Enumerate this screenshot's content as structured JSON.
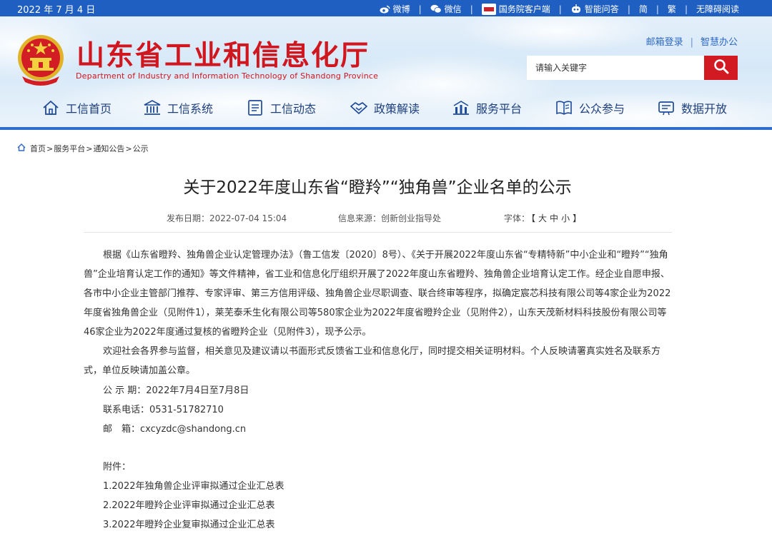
{
  "topbar": {
    "date": "2022 年 7 月 4 日",
    "links": [
      {
        "icon": "weibo-icon",
        "label": "微博"
      },
      {
        "icon": "wechat-icon",
        "label": "微信"
      },
      {
        "icon": "gwy-app-icon",
        "label": "国务院客户端"
      },
      {
        "icon": "robot-icon",
        "label": "智能问答"
      },
      {
        "icon": "",
        "label": "简"
      },
      {
        "icon": "",
        "label": "繁"
      },
      {
        "icon": "",
        "label": "无障碍阅读"
      }
    ],
    "bg_color": "#1f5fc1"
  },
  "header": {
    "title_cn": "山东省工业和信息化厅",
    "title_en": "Department of Industry and Information Technology of Shandong Province",
    "user_links": [
      "邮箱登录",
      "智慧办公"
    ],
    "search_placeholder": "请输入关键字",
    "accent_color": "#d0161f"
  },
  "nav": {
    "items": [
      {
        "icon": "home-icon",
        "label": "工信首页"
      },
      {
        "icon": "building-icon",
        "label": "工信系统"
      },
      {
        "icon": "document-icon",
        "label": "工信动态"
      },
      {
        "icon": "handshake-icon",
        "label": "政策解读"
      },
      {
        "icon": "platform-icon",
        "label": "服务平台"
      },
      {
        "icon": "book-icon",
        "label": "公众参与"
      },
      {
        "icon": "data-icon",
        "label": "数据开放"
      }
    ]
  },
  "breadcrumb": {
    "items": [
      "首页",
      "服务平台",
      "通知公告",
      "公示"
    ],
    "separator": ">"
  },
  "article": {
    "title": "关于2022年度山东省“瞪羚”“独角兽”企业名单的公示",
    "publish_date": "发布日期：2022-07-04 15:04",
    "source": "信息来源：创新创业指导处",
    "font_label": "字体：",
    "font_sizes": [
      "【",
      "大",
      "中",
      "小",
      "】"
    ],
    "paragraphs": [
      "根据《山东省瞪羚、独角兽企业认定管理办法》（鲁工信发〔2020〕8号）、《关于开展2022年度山东省“专精特新”中小企业和“瞪羚”“独角兽”企业培育认定工作的通知》等文件精神，省工业和信息化厅组织开展了2022年度山东省瞪羚、独角兽企业培育认定工作。经企业自愿申报、各市中小企业主管部门推荐、专家评审、第三方信用评级、独角兽企业尽职调查、联合终审等程序，拟确定宸芯科技有限公司等4家企业为2022年度省独角兽企业（见附件1），莱芜泰禾生化有限公司等580家企业为2022年度省瞪羚企业（见附件2），山东天茂新材料科技股份有限公司等46家企业为2022年度通过复核的省瞪羚企业（见附件3），现予公示。",
      "欢迎社会各界参与监督，相关意见及建议请以书面形式反馈省工业和信息化厅，同时提交相关证明材料。个人反映请署真实姓名及联系方式，单位反映请加盖公章。"
    ],
    "period": "公 示 期：2022年7月4日至7月8日",
    "phone": "联系电话：0531-51782710",
    "email": "邮　箱：cxcyzdc@shandong.cn",
    "attachments_label": "附件：",
    "attachments": [
      "1.2022年独角兽企业评审拟通过企业汇总表",
      "2.2022年瞪羚企业评审拟通过企业汇总表",
      "3.2022年瞪羚企业复审拟通过企业汇总表"
    ]
  }
}
